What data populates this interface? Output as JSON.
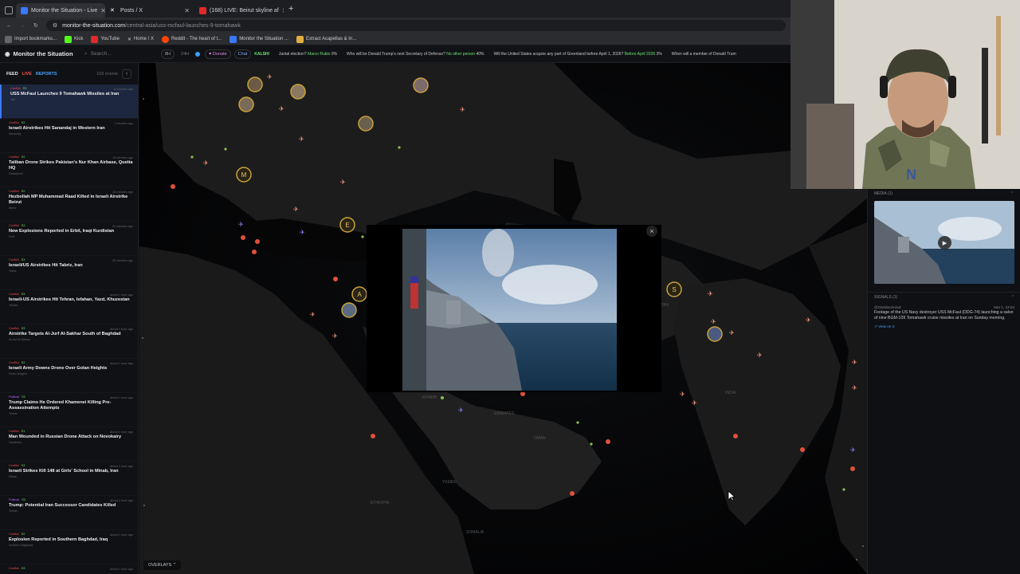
{
  "browser": {
    "tabs": [
      {
        "title": "Monitor the Situation - Live",
        "active": true
      },
      {
        "title": "Posts / X",
        "active": false
      },
      {
        "title": "(168) LIVE: Beirut skyline af",
        "active": false
      }
    ],
    "new_tab": "+",
    "url_host": "monitor-the-situation.com",
    "url_path": "/central-asia/uss-mcfaul-launches-9-tomahawk",
    "bookmarks": [
      "Import bookmarks...",
      "Kick",
      "YouTube",
      "Home / X",
      "Reddit - The heart of t...",
      "Monitor the Situation ...",
      "Extract Acapellas & In..."
    ]
  },
  "header": {
    "brand": "Monitor the Situation",
    "search_placeholder": "Search...",
    "range_a": "8H",
    "range_b": "24H",
    "donate": "Donate",
    "chat": "Chat",
    "ticker_label": "KALSHI",
    "ticker": [
      {
        "q": "Jantal election?",
        "a": "Marco Rubio",
        "p": "9%"
      },
      {
        "q": "Who will be Donald Trump's next Secretary of Defense?",
        "a": "No other person",
        "p": "40%"
      },
      {
        "q": "Will the United States acquire any part of Greenland before April 1, 2026?",
        "a": "Before April 2026",
        "p": "3%"
      },
      {
        "q": "When will a member of Donald Trum",
        "a": "",
        "p": ""
      }
    ]
  },
  "sidebar": {
    "feed": "FEED",
    "live": "LIVE",
    "reports": "REPORTS",
    "count": "158 events",
    "collapse": "‹",
    "items": [
      {
        "tag": "Conflict",
        "score": "S3",
        "time": "8 minutes ago",
        "title": "USS McFaul Launches 9 Tomahawk Missiles at Iran",
        "loc": "Iran"
      },
      {
        "tag": "Conflict",
        "score": "S2",
        "time": "7 minutes ago",
        "title": "Israeli Airstrikes Hit Sanandaj in Western Iran",
        "loc": "Sanandaj"
      },
      {
        "tag": "Conflict",
        "score": "S2",
        "time": "15 minutes ago",
        "title": "Taliban Drone Strikes Pakistan's Nur Khan Airbase, Quetta HQ",
        "loc": "Rawalpindi"
      },
      {
        "tag": "Conflict",
        "score": "S2",
        "time": "16 minutes ago",
        "title": "Hezbollah MP Muhammad Raad Killed in Israeli Airstrike Beirut",
        "loc": "Beirut"
      },
      {
        "tag": "Conflict",
        "score": "S3",
        "time": "20 minutes ago",
        "title": "New Explosions Reported in Erbil, Iraqi Kurdistan",
        "loc": "Erbil"
      },
      {
        "tag": "Conflict",
        "score": "S3",
        "time": "42 minutes ago",
        "title": "Israeli/US Airstrikes Hit Tabriz, Iran",
        "loc": "Tabriz"
      },
      {
        "tag": "Conflict",
        "score": "S3",
        "time": "about 1 hour ago",
        "title": "Israeli-US Airstrikes Hit Tehran, Isfahan, Yazd, Khuzestan",
        "loc": "Tehran"
      },
      {
        "tag": "Conflict",
        "score": "S3",
        "time": "about 1 hour ago",
        "title": "Airstrike Targets Al-Jurf Al-Sakhar South of Baghdad",
        "loc": "Al-Jurf Al-Sakhar"
      },
      {
        "tag": "Conflict",
        "score": "S2",
        "time": "about 1 hour ago",
        "title": "Israeli Army Downs Drone Over Golan Heights",
        "loc": "Golan Heights"
      },
      {
        "tag": "Political",
        "score": "S3",
        "time": "about 1 hour ago",
        "title": "Trump Claims He Ordered Khamenei Killing Pre-Assassination Attempts",
        "loc": "Tehran"
      },
      {
        "tag": "Conflict",
        "score": "S1",
        "time": "about 1 hour ago",
        "title": "Man Wounded in Russian Drone Attack on Novokairy",
        "loc": "Novokairy"
      },
      {
        "tag": "Conflict",
        "score": "S3",
        "time": "about 1 hour ago",
        "title": "Israeli Strikes Kill 148 at Girls' School in Minab, Iran",
        "loc": "Minab"
      },
      {
        "tag": "Political",
        "score": "S3",
        "time": "about 1 hour ago",
        "title": "Trump: Potential Iran Successor Candidates Killed",
        "loc": "Tehran"
      },
      {
        "tag": "Conflict",
        "score": "S2",
        "time": "about 1 hour ago",
        "title": "Explosion Reported in Southern Baghdad, Iraq",
        "loc": "Southern Baghdad"
      },
      {
        "tag": "Conflict",
        "score": "S3",
        "time": "about 1 hour ago",
        "title": "",
        "loc": ""
      }
    ]
  },
  "map": {
    "overlays": "OVERLAYS ⌃",
    "labels": [
      "RIYADH",
      "EMIRATES",
      "OMAN",
      "YEMEN",
      "ETHIOPIA",
      "SOMALIA",
      "INDIA",
      "PAKISTAN"
    ],
    "markers": [
      "M",
      "E",
      "A",
      "S"
    ]
  },
  "popup": {
    "close": "×"
  },
  "right_panel": {
    "media_header": "MEDIA (1)",
    "signals_header": "SIGNALS (1)",
    "source": "@Osinttechnical",
    "date": "Mar 1, 23:04",
    "text": "Footage of the US Navy destroyer USS McFaul (DDG-74) launching a salvo of nine BGM-109 Tomahawk cruise missiles at Iran on Sunday morning.",
    "link": "View on X"
  },
  "colors": {
    "accent": "#3a78ff",
    "conflict": "#ff4a4a",
    "political": "#c063ff",
    "score": "#6fe36f",
    "marker_gold": "#c9a13a"
  }
}
